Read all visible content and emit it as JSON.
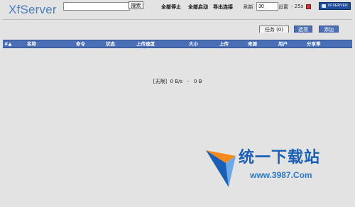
{
  "app": {
    "logo": "XfServer"
  },
  "search": {
    "value": "",
    "button_label": "搜索"
  },
  "toolbar": {
    "stop_all": "全部停止",
    "start_all": "全部启动",
    "export_links": "导出连接"
  },
  "refresh": {
    "label": "刷新",
    "value": "30"
  },
  "settings": {
    "label": "设置",
    "timer": "- 25s"
  },
  "brand_badge": {
    "text": "XFSERVER"
  },
  "tabs": [
    {
      "label": "任务 (0)",
      "active": true
    },
    {
      "label": "选项",
      "active": false
    },
    {
      "label": "添加",
      "active": false
    }
  ],
  "table": {
    "columns": [
      {
        "key": "index",
        "label": "#▲"
      },
      {
        "key": "name",
        "label": "名称"
      },
      {
        "key": "command",
        "label": "命令"
      },
      {
        "key": "status",
        "label": "状态"
      },
      {
        "key": "upload_speed",
        "label": "上传速度"
      },
      {
        "key": "size",
        "label": "大小"
      },
      {
        "key": "uploaded",
        "label": "上传"
      },
      {
        "key": "source",
        "label": "来源"
      },
      {
        "key": "user",
        "label": "用户"
      },
      {
        "key": "share_ratio",
        "label": "分享率"
      }
    ],
    "rows": []
  },
  "status": {
    "limit": "[无限]",
    "speed": "0 B/s",
    "separator": "-",
    "total": "0 B"
  },
  "watermark": {
    "text": "统一下载站",
    "url": "www.3987.Com"
  },
  "colors": {
    "background": "#e3e3e3",
    "logo": "#4a7fbf",
    "header_bar": "#4a6fb7",
    "tab_inactive": "#4b6fb2",
    "watermark_blue": "#1a5fb5",
    "watermark_orange": "#f28b1c"
  }
}
